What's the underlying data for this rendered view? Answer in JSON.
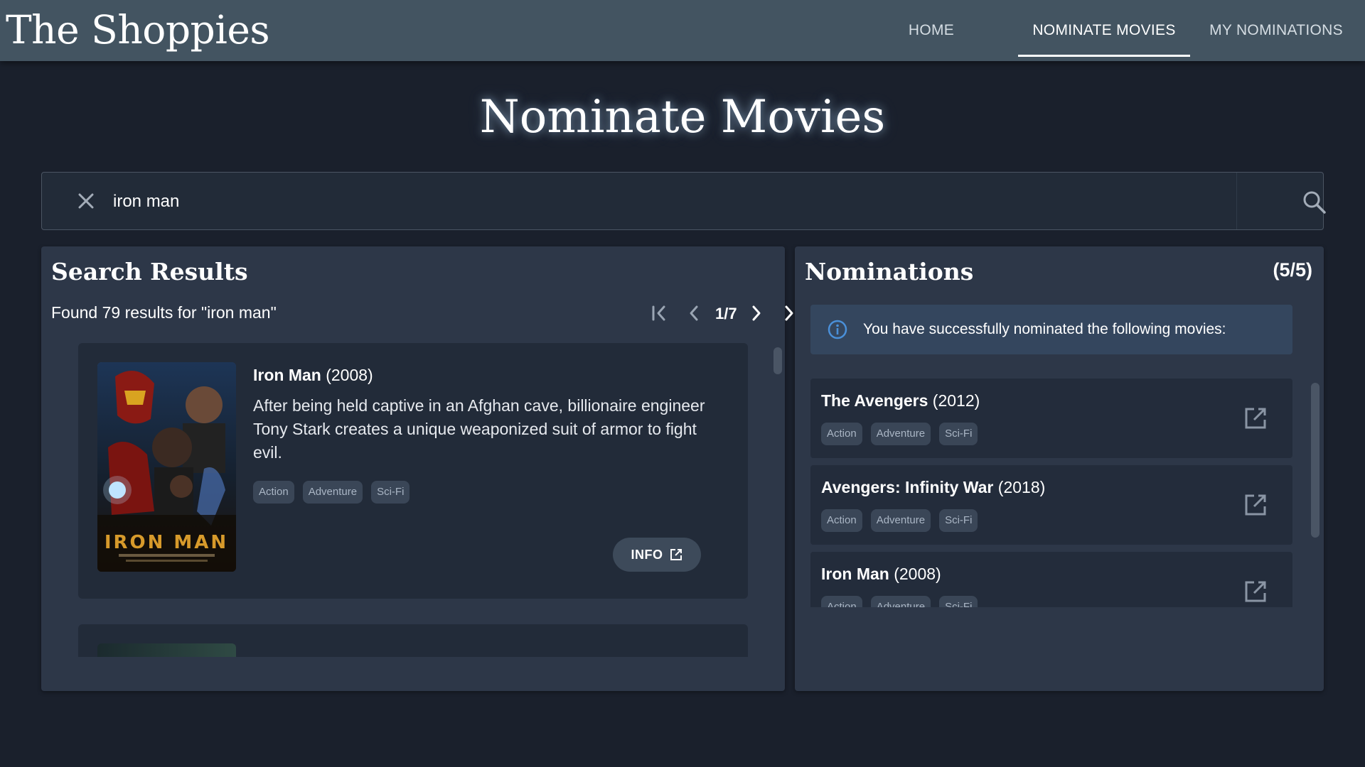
{
  "header": {
    "logo": "The Shoppies",
    "nav": [
      {
        "label": "HOME"
      },
      {
        "label": "NOMINATE MOVIES",
        "active": true
      },
      {
        "label": "MY NOMINATIONS"
      }
    ]
  },
  "page_title": "Nominate Movies",
  "search": {
    "value": "iron man",
    "clear_icon": "close-icon",
    "submit_icon": "search-icon"
  },
  "results": {
    "title": "Search Results",
    "summary": "Found 79 results for \"iron man\"",
    "pager": {
      "current": 1,
      "total": 7,
      "label": "1/7"
    },
    "movies": [
      {
        "title": "Iron Man",
        "year": "(2008)",
        "description": "After being held captive in an Afghan cave, billionaire engineer Tony Stark creates a unique weaponized suit of armor to fight evil.",
        "genres": [
          "Action",
          "Adventure",
          "Sci-Fi"
        ],
        "poster_text": "IRON MAN",
        "info_label": "INFO"
      }
    ]
  },
  "nominations": {
    "title": "Nominations",
    "count": "(5/5)",
    "alert": "You have successfully nominated the following movies:",
    "items": [
      {
        "title": "The Avengers",
        "year": "(2012)",
        "genres": [
          "Action",
          "Adventure",
          "Sci-Fi"
        ]
      },
      {
        "title": "Avengers: Infinity War",
        "year": "(2018)",
        "genres": [
          "Action",
          "Adventure",
          "Sci-Fi"
        ]
      },
      {
        "title": "Iron Man",
        "year": "(2008)",
        "genres": [
          "Action",
          "Adventure",
          "Sci-Fi"
        ]
      }
    ]
  },
  "colors": {
    "header_bg": "#435461",
    "page_bg": "#1a202c",
    "panel_bg": "#2d3748",
    "card_bg": "#222b39",
    "alert_bg": "#34465e",
    "info_icon": "#4a90d9"
  }
}
